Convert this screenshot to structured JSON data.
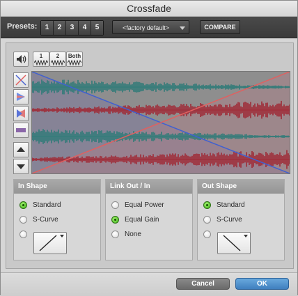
{
  "window": {
    "title": "Crossfade"
  },
  "toolbar": {
    "presets_label": "Presets:",
    "preset_buttons": [
      "1",
      "2",
      "3",
      "4",
      "5"
    ],
    "factory_default": "<factory default>",
    "compare_label": "COMPARE"
  },
  "tools": {
    "link_1": "1",
    "link_2": "2",
    "link_both": "Both"
  },
  "sections": {
    "in_shape": {
      "title": "In Shape",
      "options": [
        "Standard",
        "S-Curve"
      ],
      "selected": "Standard"
    },
    "link": {
      "title": "Link Out / In",
      "options": [
        "Equal Power",
        "Equal Gain",
        "None"
      ],
      "selected": "Equal Gain"
    },
    "out_shape": {
      "title": "Out Shape",
      "options": [
        "Standard",
        "S-Curve"
      ],
      "selected": "Standard"
    }
  },
  "footer": {
    "cancel_label": "Cancel",
    "ok_label": "OK"
  },
  "colors": {
    "fade_in_curve": "#e06060",
    "fade_out_curve": "#4060d0",
    "waveform_teal": "#2f7b78",
    "waveform_red": "#9f2a36",
    "ok_blue": "#4f8fcf"
  }
}
